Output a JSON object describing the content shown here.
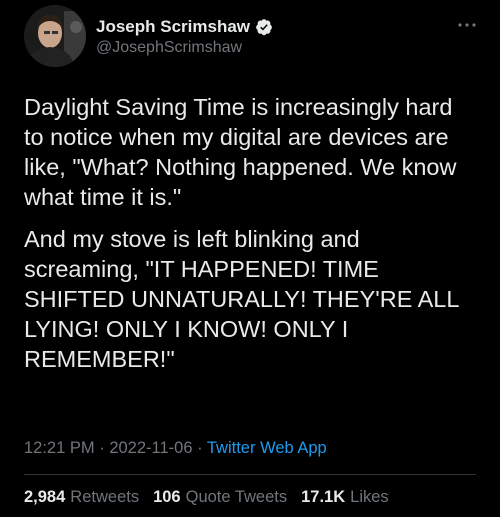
{
  "author": {
    "name": "Joseph Scrimshaw",
    "handle": "@JosephScrimshaw",
    "verified": true
  },
  "tweet": {
    "paragraphs": [
      "Daylight Saving Time is increasingly hard to notice when my digital are devices are like, \"What? Nothing happened. We know what time it is.\"",
      "And my stove is left blinking and screaming, \"IT HAPPENED! TIME SHIFTED UNNATURALLY! THEY'RE ALL LYING! ONLY I KNOW! ONLY I REMEMBER!\""
    ],
    "time": "12:21 PM",
    "separator": "·",
    "date": "2022-11-06",
    "app": "Twitter Web App"
  },
  "stats": {
    "retweets_count": "2,984",
    "retweets_label": "Retweets",
    "quotes_count": "106",
    "quotes_label": "Quote Tweets",
    "likes_count": "17.1K",
    "likes_label": "Likes"
  },
  "colors": {
    "background": "#000000",
    "text": "#e7e9ea",
    "muted": "#71767b",
    "accent": "#1d9bf0"
  },
  "icons": [
    "verified-badge-icon",
    "more-icon"
  ]
}
